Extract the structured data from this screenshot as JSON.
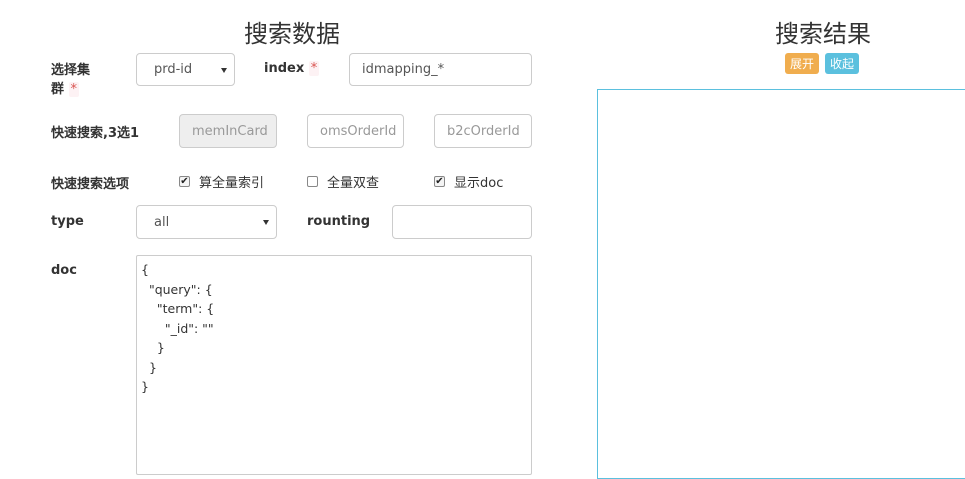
{
  "left_title": "搜索数据",
  "right_title": "搜索结果",
  "cluster": {
    "label": "选择集群",
    "required_mark": "*",
    "value": "prd-id"
  },
  "index": {
    "label": "index",
    "required_mark": "*",
    "value": "idmapping_*"
  },
  "quick_search": {
    "label": "快速搜索,3选1",
    "fields": [
      {
        "placeholder": "memInCard"
      },
      {
        "placeholder": "omsOrderId"
      },
      {
        "placeholder": "b2cOrderId"
      }
    ]
  },
  "options": {
    "label": "快速搜索选项",
    "items": [
      {
        "label": "算全量索引",
        "checked": true
      },
      {
        "label": "全量双查",
        "checked": false
      },
      {
        "label": "显示doc",
        "checked": true
      }
    ]
  },
  "type": {
    "label": "type",
    "value": "all"
  },
  "routing": {
    "label": "rounting",
    "value": ""
  },
  "doc": {
    "label": "doc",
    "value": "{\n  \"query\": {\n    \"term\": {\n      \"_id\": \"\"\n    }\n  }\n}"
  },
  "buttons": {
    "expand": "展开",
    "collapse": "收起"
  },
  "colors": {
    "expand": "#f0ad4e",
    "collapse": "#5bc0de",
    "border_result": "#5bc0de"
  }
}
